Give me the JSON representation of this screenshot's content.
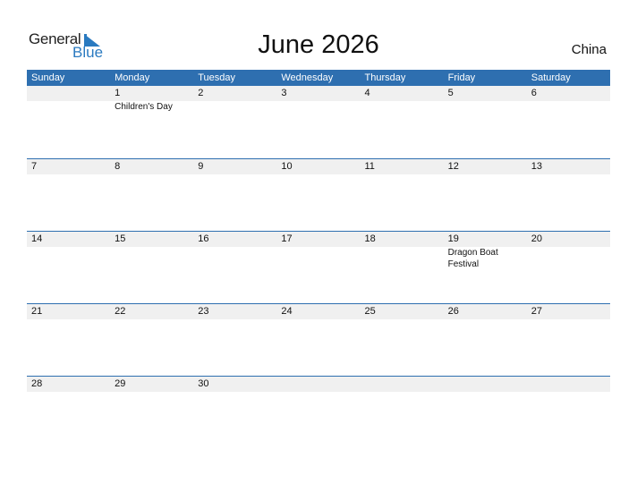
{
  "logo": {
    "general": "General",
    "blue": "Blue"
  },
  "title": "June 2026",
  "country": "China",
  "weekdays": [
    "Sunday",
    "Monday",
    "Tuesday",
    "Wednesday",
    "Thursday",
    "Friday",
    "Saturday"
  ],
  "weeks": [
    {
      "days": [
        "",
        "1",
        "2",
        "3",
        "4",
        "5",
        "6"
      ],
      "events": [
        "",
        "Children's Day",
        "",
        "",
        "",
        "",
        ""
      ]
    },
    {
      "days": [
        "7",
        "8",
        "9",
        "10",
        "11",
        "12",
        "13"
      ],
      "events": [
        "",
        "",
        "",
        "",
        "",
        "",
        ""
      ]
    },
    {
      "days": [
        "14",
        "15",
        "16",
        "17",
        "18",
        "19",
        "20"
      ],
      "events": [
        "",
        "",
        "",
        "",
        "",
        "Dragon Boat Festival",
        ""
      ]
    },
    {
      "days": [
        "21",
        "22",
        "23",
        "24",
        "25",
        "26",
        "27"
      ],
      "events": [
        "",
        "",
        "",
        "",
        "",
        "",
        ""
      ]
    },
    {
      "days": [
        "28",
        "29",
        "30",
        "",
        "",
        "",
        ""
      ],
      "events": [
        "",
        "",
        "",
        "",
        "",
        "",
        ""
      ]
    }
  ]
}
